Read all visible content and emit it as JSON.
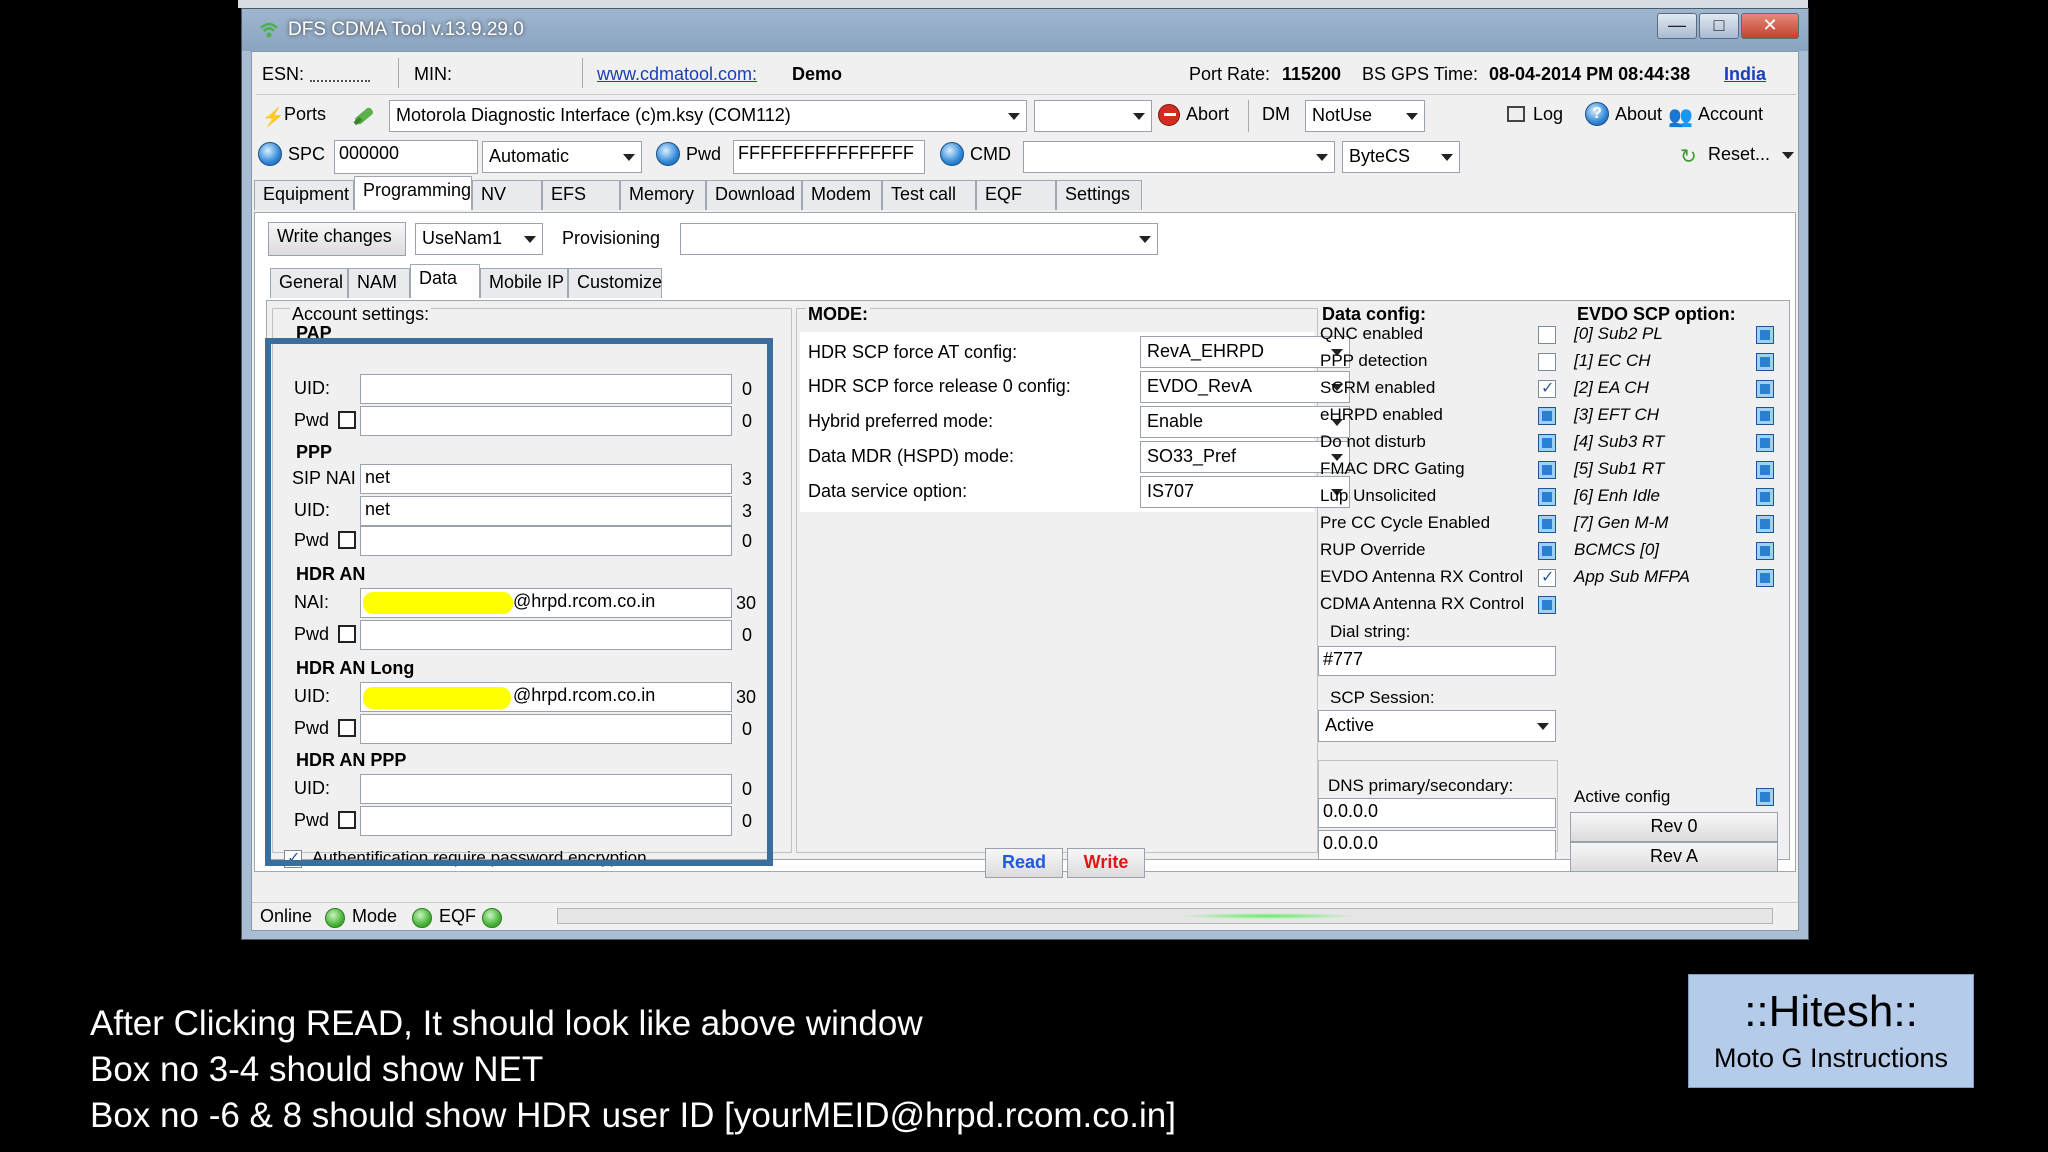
{
  "window": {
    "title": "DFS CDMA Tool v.13.9.29.0",
    "controls": {
      "minimize": "—",
      "maximize": "□",
      "close": "✕"
    }
  },
  "row1": {
    "esn_label": "ESN:",
    "min_label": "MIN:",
    "link": "www.cdmatool.com:",
    "mode": "Demo",
    "port_rate_label": "Port Rate:",
    "port_rate_value": "115200",
    "bs_gps_label": "BS GPS Time:",
    "bs_gps_value": "08-04-2014 PM 08:44:38",
    "country": "India"
  },
  "row2": {
    "ports_label": "Ports",
    "interface": "Motorola Diagnostic Interface (c)m.ksy (COM112)",
    "abort": "Abort",
    "dm_label": "DM",
    "dm_value": "NotUse",
    "log": "Log",
    "about": "About",
    "account": "Account"
  },
  "row3": {
    "spc_label": "SPC",
    "spc_value": "000000",
    "spc_mode": "Automatic",
    "pwd_label": "Pwd",
    "pwd_value": "FFFFFFFFFFFFFFFF",
    "cmd_label": "CMD",
    "cmd_value": "",
    "format": "ByteCS",
    "reset": "Reset..."
  },
  "main_tabs": [
    "Equipment",
    "Programming",
    "NV",
    "EFS",
    "Memory",
    "Download",
    "Modem",
    "Test call",
    "EQF",
    "Settings"
  ],
  "toolbar": {
    "write_changes": "Write changes",
    "nam": "UseNam1",
    "provisioning_label": "Provisioning",
    "provisioning_value": ""
  },
  "sub_tabs": [
    "General",
    "NAM",
    "Data",
    "Mobile IP",
    "Customize"
  ],
  "account": {
    "header": "Account settings:",
    "pap": {
      "title": "PAP",
      "uid_label": "UID:",
      "uid_value": "",
      "uid_count": "0",
      "pwd_label": "Pwd",
      "pwd_value": "",
      "pwd_count": "0"
    },
    "ppp": {
      "title": "PPP",
      "sipnai_label": "SIP NAI",
      "sipnai_value": "net",
      "sipnai_count": "3",
      "uid_label": "UID:",
      "uid_value": "net",
      "uid_count": "3",
      "pwd_label": "Pwd",
      "pwd_value": "",
      "pwd_count": "0"
    },
    "hdr_an": {
      "title": "HDR AN",
      "nai_label": "NAI:",
      "nai_value": "@hrpd.rcom.co.in",
      "nai_count": "30",
      "pwd_label": "Pwd",
      "pwd_value": "",
      "pwd_count": "0"
    },
    "hdr_an_long": {
      "title": "HDR AN Long",
      "uid_label": "UID:",
      "uid_value": "@hrpd.rcom.co.in",
      "uid_count": "30",
      "pwd_label": "Pwd",
      "pwd_value": "",
      "pwd_count": "0"
    },
    "hdr_an_ppp": {
      "title": "HDR AN PPP",
      "uid_label": "UID:",
      "uid_value": "",
      "uid_count": "0",
      "pwd_label": "Pwd",
      "pwd_value": "",
      "pwd_count": "0"
    },
    "auth_text": "Authentification require password encryption"
  },
  "mode": {
    "title": "MODE:",
    "rows": [
      {
        "label": "HDR SCP force AT config:",
        "value": "RevA_EHRPD"
      },
      {
        "label": "HDR SCP force release 0 config:",
        "value": "EVDO_RevA"
      },
      {
        "label": "Hybrid preferred mode:",
        "value": "Enable"
      },
      {
        "label": "Data MDR (HSPD) mode:",
        "value": "SO33_Pref"
      },
      {
        "label": "Data service option:",
        "value": "IS707"
      }
    ],
    "read": "Read",
    "write": "Write"
  },
  "data_config": {
    "title": "Data config:",
    "items": [
      {
        "label": "QNC enabled",
        "state": "off"
      },
      {
        "label": "PPP detection",
        "state": "off"
      },
      {
        "label": "SCRM enabled",
        "state": "check"
      },
      {
        "label": "eHRPD enabled",
        "state": "on"
      },
      {
        "label": "Do not disturb",
        "state": "on"
      },
      {
        "label": "FMAC DRC Gating",
        "state": "on"
      },
      {
        "label": "Lup Unsolicited",
        "state": "on"
      },
      {
        "label": "Pre CC Cycle Enabled",
        "state": "on"
      },
      {
        "label": "RUP Override",
        "state": "on"
      },
      {
        "label": "EVDO Antenna RX Control",
        "state": "check"
      },
      {
        "label": "CDMA Antenna RX Control",
        "state": "on"
      }
    ],
    "dial_label": "Dial string:",
    "dial_value": "#777",
    "scp_label": "SCP Session:",
    "scp_value": "Active",
    "dns_label": "DNS primary/secondary:",
    "dns_primary": "0.0.0.0",
    "dns_secondary": "0.0.0.0"
  },
  "evdo_scp": {
    "title": "EVDO SCP option:",
    "items": [
      "[0] Sub2 PL",
      "[1] EC CH",
      "[2] EA CH",
      "[3] EFT CH",
      "[4] Sub3 RT",
      "[5] Sub1 RT",
      "[6] Enh Idle",
      "[7] Gen M-M",
      "BCMCS [0]",
      "App Sub MFPA"
    ],
    "active_config": "Active config",
    "rev0": "Rev 0",
    "reva": "Rev A"
  },
  "status": {
    "online": "Online",
    "mode": "Mode",
    "eqf": "EQF"
  },
  "captions": [
    "After Clicking READ, It should look like above window",
    "Box no 3-4 should show NET",
    "Box no -6 & 8 should show HDR user ID  [yourMEID@hrpd.rcom.co.in]"
  ],
  "badge": {
    "title": "::Hitesh::",
    "subtitle": "Moto G Instructions"
  },
  "colors": {
    "frame": "#3a6e9c",
    "read": "#1e5bd8",
    "write": "#e01818",
    "highlight": "#ffff00"
  }
}
